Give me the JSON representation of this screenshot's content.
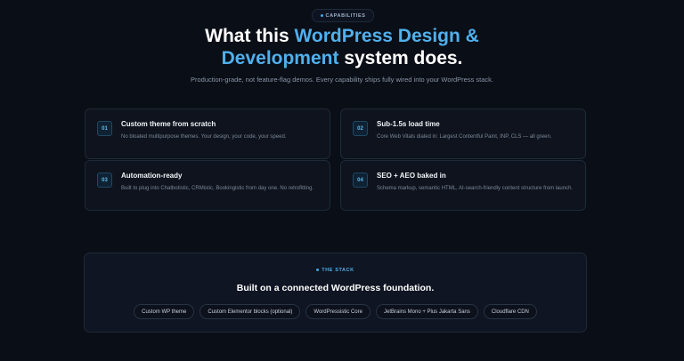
{
  "header": {
    "eyebrow": "CAPABILITIES",
    "title_part1": "What this ",
    "title_accent1": "WordPress Design &",
    "title_accent2": "Development",
    "title_part2": " system does.",
    "subtitle": "Production-grade, not feature-flag demos. Every capability ships fully wired into your WordPress stack."
  },
  "capabilities": [
    {
      "num": "01",
      "title": "Custom theme from scratch",
      "desc": "No bloated multipurpose themes. Your design, your code, your speed."
    },
    {
      "num": "02",
      "title": "Sub-1.5s load time",
      "desc": "Core Web Vitals dialed in: Largest Contentful Paint, INP, CLS — all green."
    },
    {
      "num": "03",
      "title": "Automation-ready",
      "desc": "Built to plug into Chatbotistic, CRMistic, Bookingistic from day one. No retrofitting."
    },
    {
      "num": "04",
      "title": "SEO + AEO baked in",
      "desc": "Schema markup, semantic HTML, AI-search-friendly content structure from launch."
    }
  ],
  "stack": {
    "eyebrow": "THE STACK",
    "title": "Built on a connected WordPress foundation.",
    "chips": [
      "Custom WP theme",
      "Custom Elementor blocks (optional)",
      "WordPressistic Core",
      "JetBrains Mono + Plus Jakarta Sans",
      "Cloudflare CDN"
    ]
  },
  "colors": {
    "accent": "#4fb0ee",
    "background": "#0a0e16"
  }
}
